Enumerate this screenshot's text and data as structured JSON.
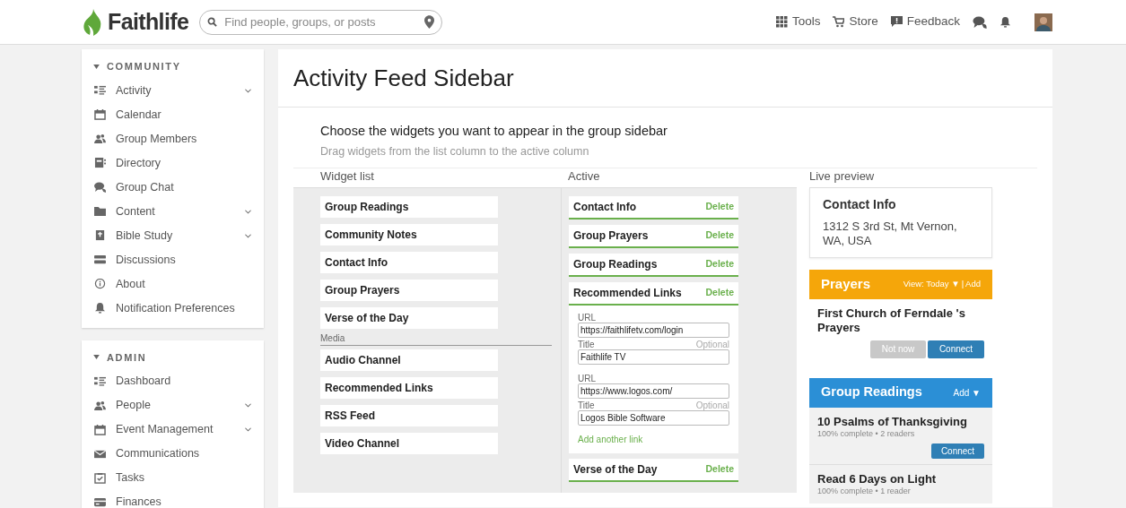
{
  "header": {
    "logo": "Faithlife",
    "search": {
      "placeholder": "Find people, groups, or posts"
    },
    "nav": [
      {
        "label": "Tools"
      },
      {
        "label": "Store"
      },
      {
        "label": "Feedback"
      }
    ]
  },
  "sidebar": {
    "sections": [
      {
        "title": "COMMUNITY",
        "expanded": true,
        "items": [
          {
            "label": "Activity",
            "has_children": true
          },
          {
            "label": "Calendar",
            "has_children": false
          },
          {
            "label": "Group Members",
            "has_children": false
          },
          {
            "label": "Directory",
            "has_children": false
          },
          {
            "label": "Group Chat",
            "has_children": false
          },
          {
            "label": "Content",
            "has_children": true
          },
          {
            "label": "Bible Study",
            "has_children": true
          },
          {
            "label": "Discussions",
            "has_children": false
          },
          {
            "label": "About",
            "has_children": false
          },
          {
            "label": "Notification Preferences",
            "has_children": false
          }
        ]
      },
      {
        "title": "ADMIN",
        "expanded": true,
        "items": [
          {
            "label": "Dashboard",
            "has_children": false
          },
          {
            "label": "People",
            "has_children": true
          },
          {
            "label": "Event Management",
            "has_children": true
          },
          {
            "label": "Communications",
            "has_children": false
          },
          {
            "label": "Tasks",
            "has_children": false
          },
          {
            "label": "Finances",
            "has_children": false
          }
        ]
      }
    ]
  },
  "main": {
    "title": "Activity Feed Sidebar",
    "heading": "Choose the widgets you want to appear in the group sidebar",
    "subheading": "Drag widgets from the list column to the active column",
    "widget_list": {
      "title": "Widget list",
      "items": [
        "Group Readings",
        "Community Notes",
        "Contact Info",
        "Group Prayers",
        "Verse of the Day"
      ],
      "media_label": "Media",
      "media_items": [
        "Audio Channel",
        "Recommended Links",
        "RSS Feed",
        "Video Channel"
      ]
    },
    "active": {
      "title": "Active",
      "widgets": [
        {
          "kind": "plain",
          "name": "Contact Info",
          "action": "Delete"
        },
        {
          "kind": "plain",
          "name": "Group Prayers",
          "action": "Delete"
        },
        {
          "kind": "plain",
          "name": "Group Readings",
          "action": "Delete"
        },
        {
          "kind": "links",
          "name": "Recommended Links",
          "action": "Delete",
          "links": [
            {
              "url_label": "URL",
              "url": "https://faithlifetv.com/login",
              "title_label": "Title",
              "optional": "Optional",
              "title": "Faithlife TV"
            },
            {
              "url_label": "URL",
              "url": "https://www.logos.com/",
              "title_label": "Title",
              "optional": "Optional",
              "title": "Logos Bible Software"
            }
          ],
          "add_link": "Add another link"
        },
        {
          "kind": "plain",
          "name": "Verse of the Day",
          "action": "Delete"
        }
      ]
    },
    "live_preview": {
      "title": "Live preview",
      "contact_info": {
        "title": "Contact Info",
        "address": "1312 S 3rd St, Mt Vernon, WA, USA"
      },
      "prayers": {
        "title": "Prayers",
        "view": "View: Today ▼",
        "separator": "|",
        "add": "Add",
        "item": "First Church of Ferndale 's Prayers",
        "secondary_button": "Not now",
        "primary_button": "Connect"
      },
      "group_readings": {
        "title": "Group Readings",
        "add": "Add ▼",
        "items": [
          {
            "title": "10 Psalms of Thanksgiving",
            "meta": "100% complete • 2 readers",
            "button": "Connect"
          },
          {
            "title": "Read 6 Days on Light",
            "meta": "100% complete • 1 reader"
          }
        ]
      }
    }
  }
}
